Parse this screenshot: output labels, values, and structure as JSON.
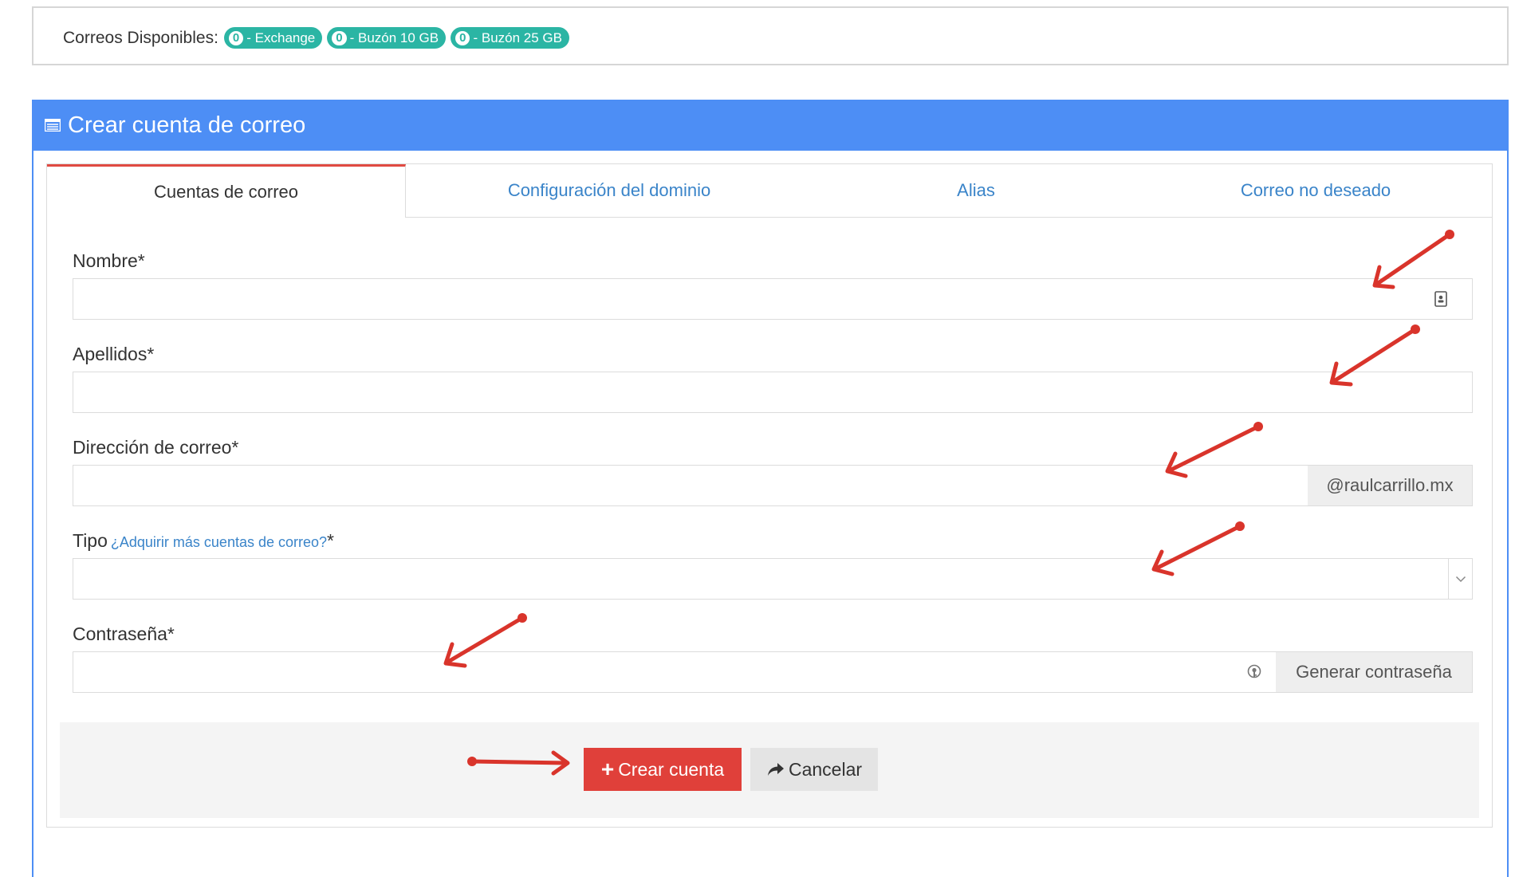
{
  "availability": {
    "label": "Correos Disponibles:",
    "badges": [
      {
        "count": "0",
        "text": "- Exchange"
      },
      {
        "count": "0",
        "text": "- Buzón 10 GB"
      },
      {
        "count": "0",
        "text": "- Buzón 25 GB"
      }
    ],
    "badge_color": "#2bb5a4"
  },
  "panel": {
    "title": "Crear cuenta de correo",
    "header_color": "#4d8ef5"
  },
  "tabs": [
    {
      "label": "Cuentas de correo",
      "active": true
    },
    {
      "label": "Configuración del dominio",
      "active": false
    },
    {
      "label": "Alias",
      "active": false
    },
    {
      "label": "Correo no deseado",
      "active": false
    }
  ],
  "form": {
    "nombre": {
      "label": "Nombre*",
      "value": ""
    },
    "apellidos": {
      "label": "Apellidos*",
      "value": ""
    },
    "correo": {
      "label": "Dirección de correo*",
      "value": "",
      "suffix": "@raulcarrillo.mx"
    },
    "tipo": {
      "label": "Tipo",
      "link": "¿Adquirir más cuentas de correo?",
      "required": "*",
      "selected": ""
    },
    "contrasena": {
      "label": "Contraseña*",
      "value": "",
      "generate_label": "Generar contraseña"
    }
  },
  "actions": {
    "create_label": "Crear cuenta",
    "create_icon": "plus-icon",
    "cancel_label": "Cancelar",
    "cancel_icon": "share-arrow-icon",
    "create_color": "#e0403a"
  },
  "annotation_color": "#d9342b"
}
